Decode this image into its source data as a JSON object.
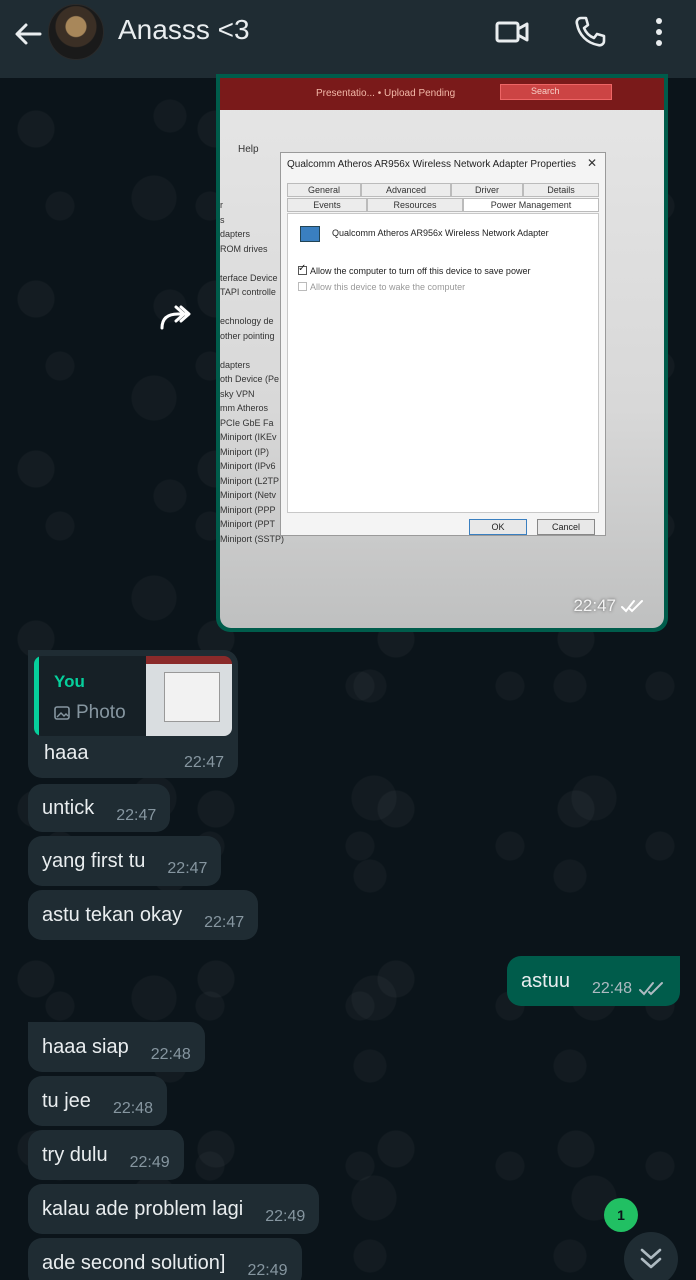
{
  "header": {
    "contact_name": "Anasss <3",
    "back_icon": "arrow-left-icon",
    "video_icon": "video-camera-icon",
    "call_icon": "phone-icon",
    "menu_icon": "more-vertical-icon"
  },
  "image_message": {
    "time": "22:47",
    "status": "read",
    "photo": {
      "app_bar_text": "Presentatio... • Upload Pending",
      "search_text": "Search",
      "menu_text": "Help",
      "device_list": [
        "r",
        "s",
        "dapters",
        "ROM drives",
        "",
        "terface Device",
        "TAPI controlle",
        "",
        "echnology de",
        "other pointing",
        "",
        "dapters",
        "oth Device (Pe",
        "sky VPN",
        "mm Atheros",
        "PCIe GbE Fa",
        "Miniport (IKEv",
        "Miniport (IP)",
        "Miniport (IPv6",
        "Miniport (L2TP",
        "Miniport (Netv",
        "Miniport (PPP",
        "Miniport (PPT",
        "Miniport (SSTP)"
      ],
      "dialog_title": "Qualcomm Atheros AR956x Wireless Network Adapter Properties",
      "tabs_row1": [
        "General",
        "Advanced",
        "Driver",
        "Details"
      ],
      "tabs_row2": [
        "Events",
        "Resources",
        "Power Management"
      ],
      "device_name": "Qualcomm Atheros AR956x Wireless Network Adapter",
      "option1": "Allow the computer to turn off this device to save power",
      "option2": "Allow this device to wake the computer",
      "ok": "OK",
      "cancel": "Cancel"
    }
  },
  "reply": {
    "author": "You",
    "quoted": "Photo",
    "text": "haaa",
    "time": "22:47"
  },
  "messages": [
    {
      "dir": "in",
      "text": "untick",
      "time": "22:47"
    },
    {
      "dir": "in",
      "text": "yang first tu",
      "time": "22:47"
    },
    {
      "dir": "in",
      "text": "astu tekan okay",
      "time": "22:47"
    },
    {
      "dir": "out",
      "text": "astuu",
      "time": "22:48"
    },
    {
      "dir": "in",
      "text": "haaa siap",
      "time": "22:48"
    },
    {
      "dir": "in",
      "text": "tu jee",
      "time": "22:48"
    },
    {
      "dir": "in",
      "text": "try dulu",
      "time": "22:49"
    },
    {
      "dir": "in",
      "text": "kalau ade problem lagi",
      "time": "22:49"
    },
    {
      "dir": "in",
      "text": "ade second solution]",
      "time": "22:49"
    }
  ],
  "unread_badge": "1",
  "colors": {
    "header_bg": "#1f2c33",
    "chat_bg": "#0b141a",
    "incoming": "#1f2c33",
    "outgoing": "#005c4b",
    "accent": "#06cf9c",
    "badge": "#21c063"
  }
}
